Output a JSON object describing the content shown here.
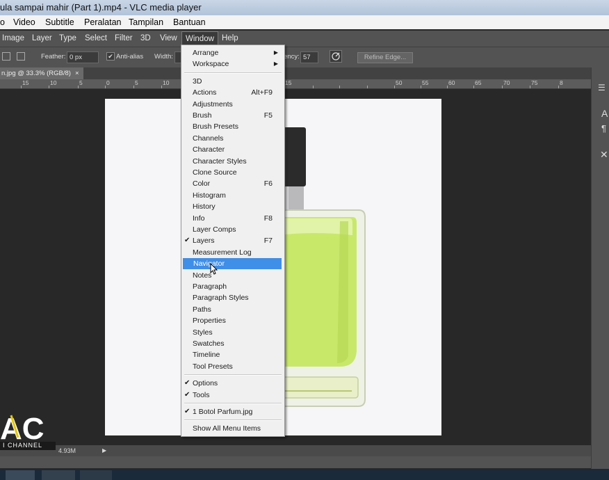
{
  "vlc": {
    "title": "ula sampai mahir (Part 1).mp4 - VLC media player",
    "menu": [
      "o",
      "Video",
      "Subtitle",
      "Peralatan",
      "Tampilan",
      "Bantuan"
    ]
  },
  "ps_menu": [
    "Image",
    "Layer",
    "Type",
    "Select",
    "Filter",
    "3D",
    "View",
    "Window",
    "Help"
  ],
  "options": {
    "feather_label": "Feather:",
    "feather_value": "0 px",
    "antialias_label": "Anti-alias",
    "width_label": "Width:",
    "opacity_label": "ency:",
    "opacity_value": "57",
    "refine_edge": "Refine Edge..."
  },
  "doc_tab": {
    "label": "n.jpg @ 33.3% (RGB/8)",
    "close": "×"
  },
  "ruler": [
    "15",
    "10",
    "5",
    "0",
    "5",
    "10",
    "15",
    "50",
    "55",
    "60",
    "65",
    "70",
    "75",
    "8"
  ],
  "status": {
    "size": "4.93M"
  },
  "window_menu": {
    "items": [
      {
        "label": "Arrange",
        "submenu": true
      },
      {
        "label": "Workspace",
        "submenu": true
      },
      {
        "sep": true
      },
      {
        "label": "3D"
      },
      {
        "label": "Actions",
        "shortcut": "Alt+F9"
      },
      {
        "label": "Adjustments"
      },
      {
        "label": "Brush",
        "shortcut": "F5"
      },
      {
        "label": "Brush Presets"
      },
      {
        "label": "Channels"
      },
      {
        "label": "Character"
      },
      {
        "label": "Character Styles"
      },
      {
        "label": "Clone Source"
      },
      {
        "label": "Color",
        "shortcut": "F6"
      },
      {
        "label": "Histogram"
      },
      {
        "label": "History"
      },
      {
        "label": "Info",
        "shortcut": "F8"
      },
      {
        "label": "Layer Comps"
      },
      {
        "label": "Layers",
        "shortcut": "F7",
        "checked": true
      },
      {
        "label": "Measurement Log"
      },
      {
        "label": "Navigator",
        "highlighted": true
      },
      {
        "label": "Notes"
      },
      {
        "label": "Paragraph"
      },
      {
        "label": "Paragraph Styles"
      },
      {
        "label": "Paths"
      },
      {
        "label": "Properties"
      },
      {
        "label": "Styles"
      },
      {
        "label": "Swatches"
      },
      {
        "label": "Timeline"
      },
      {
        "label": "Tool Presets"
      },
      {
        "sep": true
      },
      {
        "label": "Options",
        "checked": true
      },
      {
        "label": "Tools",
        "checked": true
      },
      {
        "sep": true
      },
      {
        "label": "1 Botol Parfum.jpg",
        "checked": true
      },
      {
        "sep": true
      },
      {
        "label": "Show All Menu Items"
      }
    ]
  },
  "watermark": {
    "logo": "AC",
    "sub": "I CHANNEL"
  },
  "colors": {
    "highlight": "#3f8ee8",
    "ps_menu_bg": "#535353",
    "perfume": "#c8e86a"
  }
}
